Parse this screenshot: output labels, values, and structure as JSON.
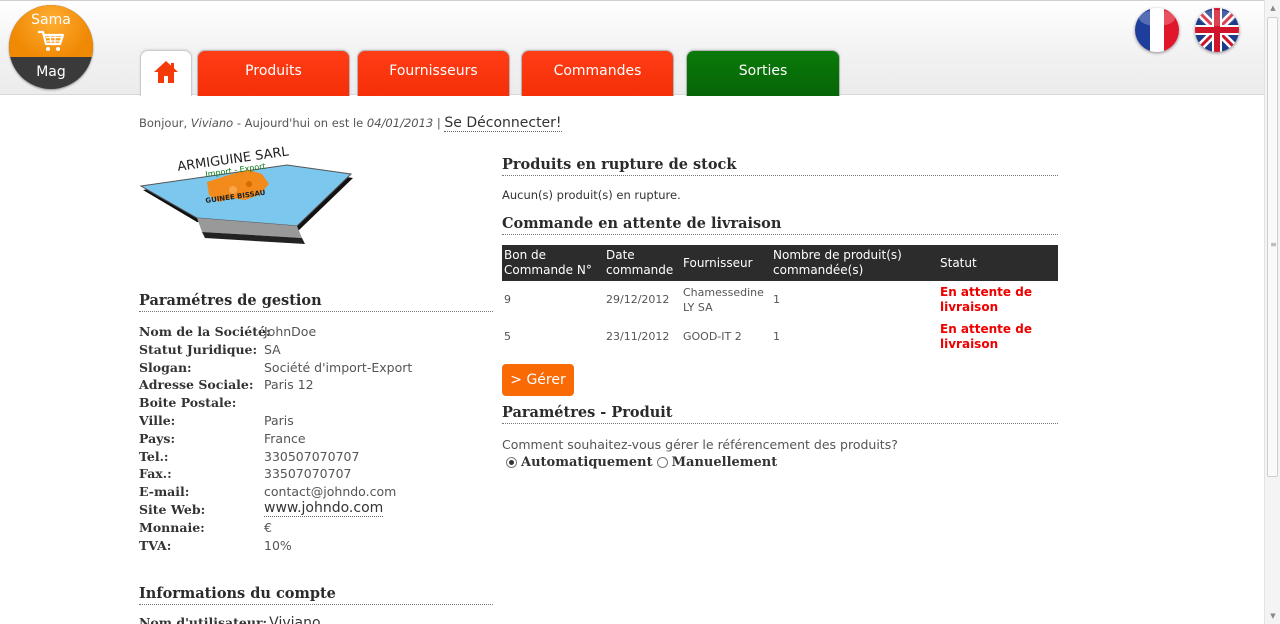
{
  "brand": {
    "line1": "Sama",
    "line2": "Mag"
  },
  "nav": {
    "tabs": [
      {
        "label": "Produits"
      },
      {
        "label": "Fournisseurs"
      },
      {
        "label": "Commandes"
      },
      {
        "label": "Sorties"
      }
    ],
    "home_icon": "home-icon",
    "tab_colors": {
      "red": "#f52f08",
      "green": "#066506"
    }
  },
  "languages": [
    {
      "icon": "france-flag-icon"
    },
    {
      "icon": "uk-flag-icon"
    }
  ],
  "greeting": {
    "hello": "Bonjour,",
    "user": "Viviano",
    "date_prefix": "- Aujourd'hui on est le",
    "date": "04/01/2013",
    "separator": "|",
    "logout": "Se Déconnecter!"
  },
  "company_logo": {
    "name": "ARMIGUINE SARL",
    "tagline": "Import - Export",
    "country": "GUINEE BISSAU"
  },
  "settings": {
    "title": "Paramétres de gestion",
    "rows": [
      {
        "label": "Nom de la Société:",
        "value": "JohnDoe"
      },
      {
        "label": "Statut Juridique:",
        "value": "SA"
      },
      {
        "label": "Slogan:",
        "value": "Société d'import-Export"
      },
      {
        "label": "Adresse Sociale:",
        "value": "Paris 12"
      },
      {
        "label": "Boite Postale:",
        "value": ""
      },
      {
        "label": "Ville:",
        "value": "Paris"
      },
      {
        "label": "Pays:",
        "value": "France"
      },
      {
        "label": "Tel.:",
        "value": "330507070707"
      },
      {
        "label": "Fax.:",
        "value": "33507070707"
      },
      {
        "label": "E-mail:",
        "value": "contact@johndo.com"
      },
      {
        "label": "Site Web:",
        "value": "www.johndo.com"
      },
      {
        "label": "Monnaie:",
        "value": "€"
      },
      {
        "label": "TVA:",
        "value": "10%"
      }
    ]
  },
  "account": {
    "title": "Informations du compte",
    "username_label": "Nom d'utilisateur:",
    "username_value": "Viviano"
  },
  "stock": {
    "title": "Produits en rupture de stock",
    "message": "Aucun(s) produit(s) en rupture."
  },
  "orders": {
    "title": "Commande en attente de livraison",
    "headers": [
      "Bon de Commande N°",
      "Date commande",
      "Fournisseur",
      "Nombre de produit(s) commandée(s)",
      "Statut"
    ],
    "rows": [
      {
        "bon": "9",
        "date": "29/12/2012",
        "fournisseur": "Chamessedine LY SA",
        "nombre": "1",
        "statut": "En attente de livraison"
      },
      {
        "bon": "5",
        "date": "23/11/2012",
        "fournisseur": "GOOD-IT 2",
        "nombre": "1",
        "statut": "En attente de livraison"
      }
    ],
    "manage_button": "> Gérer",
    "status_color": "#e00000"
  },
  "product_settings": {
    "title": "Paramétres - Produit",
    "question": "Comment souhaitez-vous gérer le référencement des produits?",
    "options": [
      {
        "label": "Automatiquement",
        "selected": true
      },
      {
        "label": "Manuellement",
        "selected": false
      }
    ]
  }
}
